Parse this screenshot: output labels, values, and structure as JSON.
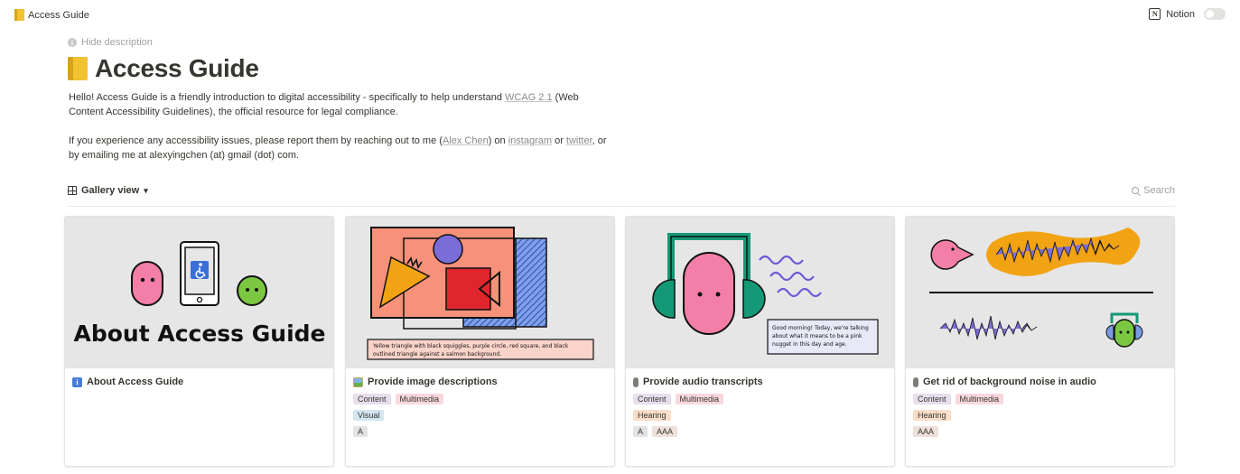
{
  "topbar": {
    "breadcrumb": "Access Guide",
    "workspace": "Notion",
    "notion_logo": "N"
  },
  "description_toggle": "Hide description",
  "page": {
    "title": "Access Guide"
  },
  "description": {
    "p1_before": "Hello! Access Guide is a friendly introduction to digital accessibility - specifically to help understand ",
    "p1_link": "WCAG 2.1",
    "p1_after": " (Web Content Accessibility Guidelines), the official resource for legal compliance.",
    "p2_part1": "If you experience any accessibility issues, please report them by reaching out to me (",
    "p2_link_name": "Alex Chen",
    "p2_part2": ") on ",
    "p2_link_instagram": "instagram",
    "p2_part3": " or ",
    "p2_link_twitter": "twitter",
    "p2_part4": ", or by emailing me at alexyingchen (at) gmail (dot) com."
  },
  "view": {
    "name": "Gallery view",
    "search_label": "Search"
  },
  "cards": [
    {
      "title": "About Access Guide",
      "icon": "info-icon",
      "cover_text": "About Access Guide",
      "tags": []
    },
    {
      "title": "Provide image descriptions",
      "icon": "picture-icon",
      "cover_caption_line1": "Yellow triangle with black squiggles, purple circle, red square, and black",
      "cover_caption_line2": "outlined triangle against a salmon background.",
      "tags": [
        [
          "Content",
          "Multimedia"
        ],
        [
          "Visual"
        ],
        [
          "A"
        ]
      ]
    },
    {
      "title": "Provide audio transcripts",
      "icon": "microphone-icon",
      "cover_bubble_line1": "Good morning! Today, we're talking",
      "cover_bubble_line2": "about what it means to be a pink",
      "cover_bubble_line3": "nugget in this day and age.",
      "tags": [
        [
          "Content",
          "Multimedia"
        ],
        [
          "Hearing"
        ],
        [
          "A",
          "AAA"
        ]
      ]
    },
    {
      "title": "Get rid of background noise in audio",
      "icon": "microphone-icon",
      "tags": [
        [
          "Content",
          "Multimedia"
        ],
        [
          "Hearing"
        ],
        [
          "AAA"
        ]
      ]
    }
  ],
  "colors": {
    "pink": "#f37fa8",
    "green": "#7cc741",
    "salmon": "#f7917a",
    "purple": "#7b6dd8",
    "red": "#e0262d",
    "blue": "#4a7bd8",
    "teal": "#149876",
    "orange": "#f2a313"
  }
}
